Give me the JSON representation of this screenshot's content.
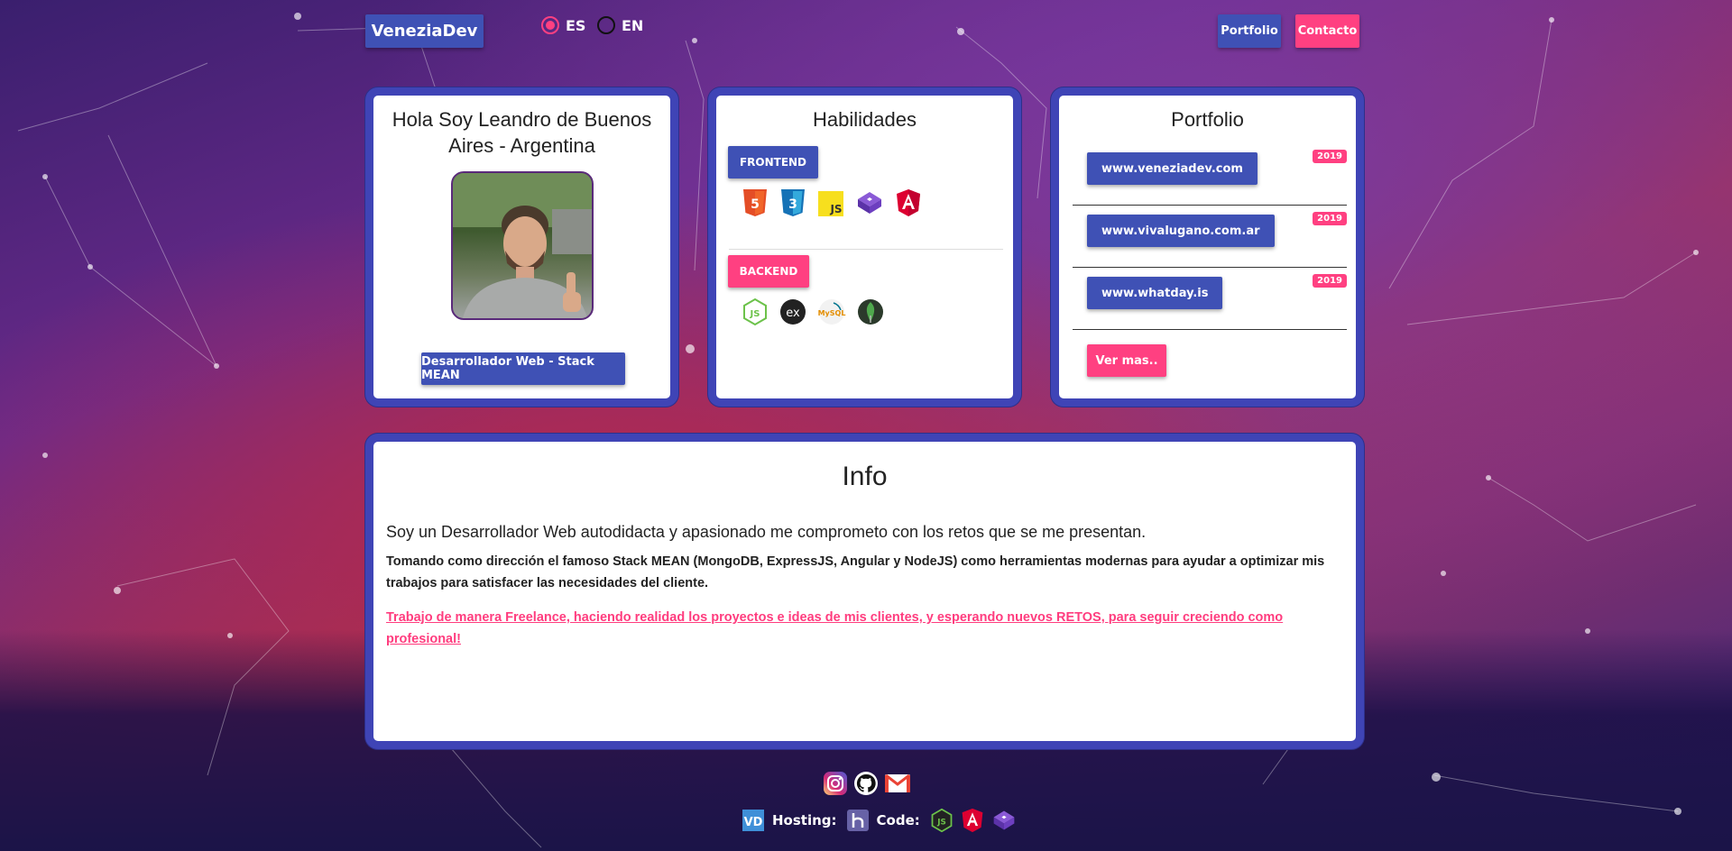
{
  "navbar": {
    "brand": "VeneziaDev",
    "languages": [
      {
        "code": "ES",
        "selected": true
      },
      {
        "code": "EN",
        "selected": false
      }
    ],
    "buttons": [
      {
        "label": "Portfolio",
        "color": "#3f51b5"
      },
      {
        "label": "Contacto",
        "color": "#ff4081"
      }
    ]
  },
  "profile": {
    "title": "Hola Soy Leandro de Buenos Aires - Argentina",
    "role_button": "Desarrollador Web - Stack MEAN"
  },
  "skills": {
    "title": "Habilidades",
    "frontend": {
      "label": "FRONTEND",
      "icons": [
        "html5-icon",
        "css3-icon",
        "javascript-icon",
        "bootstrap-icon",
        "angular-icon"
      ]
    },
    "backend": {
      "label": "BACKEND",
      "icons": [
        "nodejs-icon",
        "express-icon",
        "mysql-icon",
        "mongodb-icon"
      ]
    }
  },
  "portfolio": {
    "title": "Portfolio",
    "items": [
      {
        "url": "www.veneziadev.com",
        "year": "2019"
      },
      {
        "url": "www.vivalugano.com.ar",
        "year": "2019"
      },
      {
        "url": "www.whatday.is",
        "year": "2019"
      }
    ],
    "more_button": "Ver mas.."
  },
  "info": {
    "title": "Info",
    "lead": "Soy un Desarrollador Web autodidacta y apasionado me comprometo con los retos que se me presentan.",
    "body": "Tomando como dirección el famoso Stack MEAN (MongoDB, ExpressJS, Angular y NodeJS) como herramientas modernas para ayudar a optimizar mis trabajos para satisfacer las necesidades del cliente.",
    "freelance_link": "Trabajo de manera Freelance, haciendo realidad los proyectos e ideas de mis clientes, y esperando nuevos RETOS, para seguir creciendo como profesional!"
  },
  "footer": {
    "social_icons": [
      "instagram-icon",
      "github-icon",
      "gmail-icon"
    ],
    "hosting_label": "Hosting:",
    "code_label": "Code:"
  },
  "colors": {
    "primary": "#3f51b5",
    "accent": "#ff4081",
    "card_border": "#3f44b6"
  }
}
